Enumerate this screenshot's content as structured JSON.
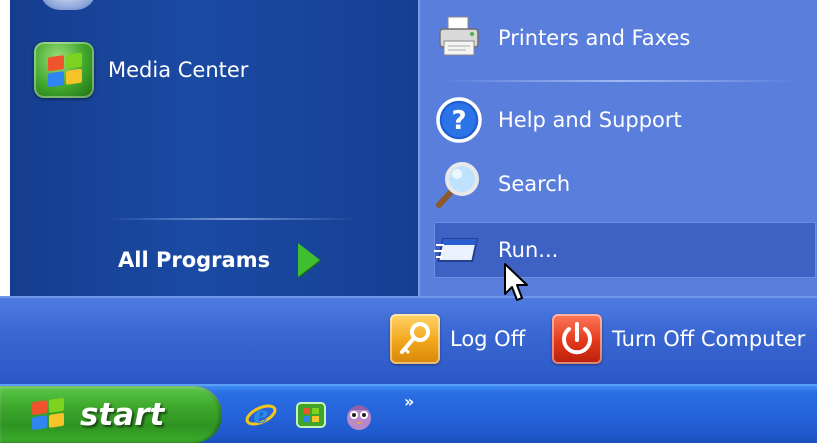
{
  "start_menu": {
    "left_pane": {
      "items": [
        {
          "label": "Media Center",
          "icon": "media-center-icon"
        }
      ],
      "all_programs": {
        "label": "All Programs",
        "icon": "green-arrow-right-icon"
      }
    },
    "right_pane": {
      "items": [
        {
          "label": "Printers and Faxes",
          "icon": "printer-icon"
        },
        {
          "label": "Help and Support",
          "icon": "help-question-icon"
        },
        {
          "label": "Search",
          "icon": "magnifier-icon"
        },
        {
          "label": "Run...",
          "icon": "run-window-icon",
          "state": "hovered"
        }
      ]
    },
    "bottom_bar": {
      "log_off": {
        "label": "Log Off",
        "icon": "key-icon"
      },
      "turn_off": {
        "label": "Turn Off Computer",
        "icon": "power-icon"
      }
    }
  },
  "taskbar": {
    "start_button": {
      "label": "start",
      "icon": "windows-flag-icon"
    },
    "quick_launch": [
      {
        "icon": "internet-explorer-icon"
      },
      {
        "icon": "windows-media-icon"
      },
      {
        "icon": "messenger-icon"
      }
    ],
    "overflow_chevron": "»"
  },
  "colors": {
    "left_pane": "#1b4aa3",
    "right_pane": "#5a7edc",
    "highlight": "#3d62c4",
    "start_green": "#3ba52a",
    "taskbar_blue": "#2563da"
  }
}
